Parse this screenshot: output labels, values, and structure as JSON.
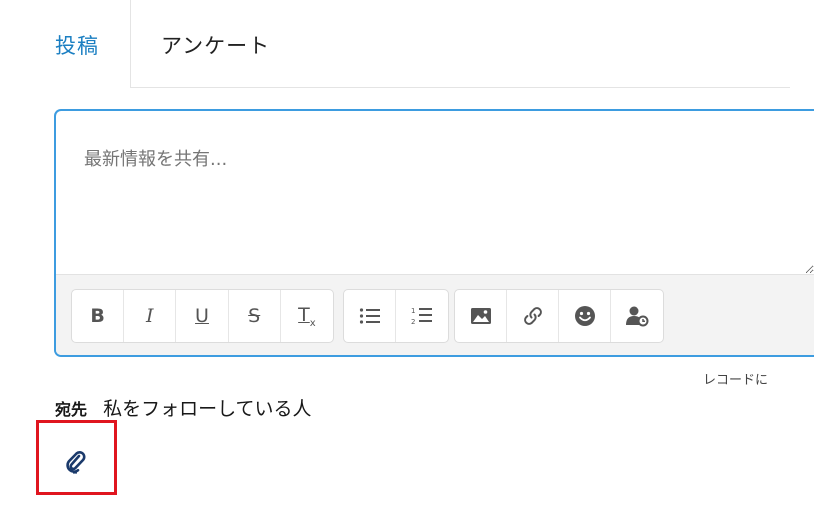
{
  "tabs": {
    "post_label": "投稿",
    "poll_label": "アンケート"
  },
  "composer": {
    "placeholder": "最新情報を共有..."
  },
  "toolbar": {
    "format_group": [
      {
        "name": "bold",
        "glyph": "B"
      },
      {
        "name": "italic",
        "glyph": "I"
      },
      {
        "name": "underline",
        "glyph": "U"
      },
      {
        "name": "strikethrough",
        "glyph": "S"
      },
      {
        "name": "remove-format",
        "glyph": "T"
      }
    ],
    "list_group": [
      {
        "name": "bullet-list"
      },
      {
        "name": "numbered-list"
      }
    ],
    "insert_group": [
      {
        "name": "image"
      },
      {
        "name": "link"
      },
      {
        "name": "emoji"
      },
      {
        "name": "mention"
      }
    ]
  },
  "record_note": "レコードに",
  "recipient": {
    "label": "宛先",
    "value": "私をフォローしている人"
  },
  "attach": {
    "icon": "paperclip-icon",
    "highlight_color": "#e0151f"
  },
  "colors": {
    "accent": "#1b7fc2",
    "focus_border": "#3d9ce0",
    "attach_icon": "#1b3a6b"
  }
}
